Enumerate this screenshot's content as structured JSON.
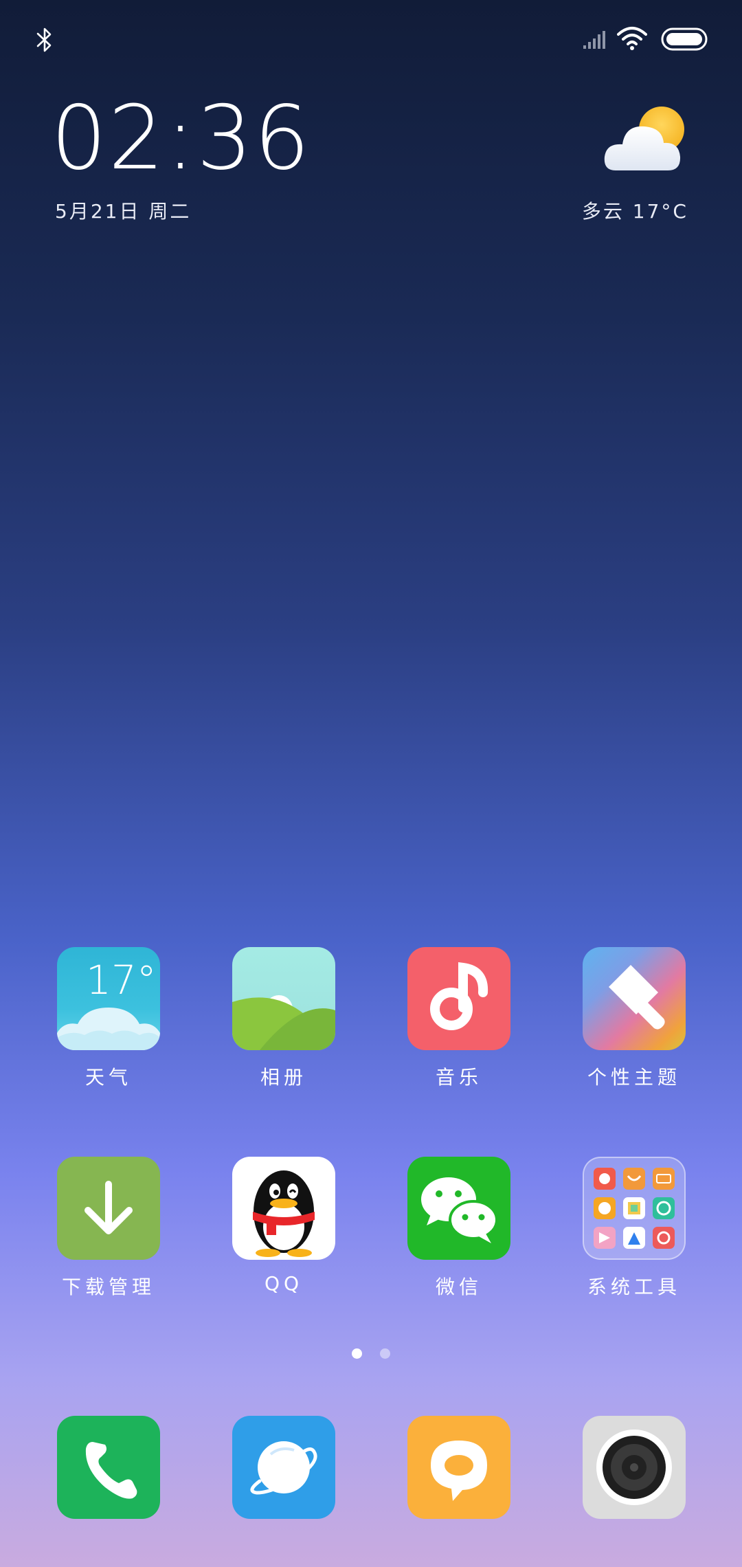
{
  "status_bar": {
    "bluetooth_icon": "bluetooth-icon",
    "signal_icon": "signal-icon",
    "wifi_icon": "wifi-icon",
    "battery_icon": "battery-icon"
  },
  "clock": {
    "time": "02:36",
    "date": "5月21日  周二"
  },
  "weather": {
    "icon": "partly-cloudy-icon",
    "text": "多云  17°C"
  },
  "apps": [
    {
      "label": "天气",
      "icon": "weather-app-icon",
      "badge_text": "17°"
    },
    {
      "label": "相册",
      "icon": "gallery-icon"
    },
    {
      "label": "音乐",
      "icon": "music-icon"
    },
    {
      "label": "个性主题",
      "icon": "themes-icon"
    },
    {
      "label": "下载管理",
      "icon": "downloads-icon"
    },
    {
      "label": "QQ",
      "icon": "qq-icon"
    },
    {
      "label": "微信",
      "icon": "wechat-icon"
    },
    {
      "label": "系统工具",
      "icon": "system-tools-folder-icon"
    }
  ],
  "dock": [
    {
      "icon": "phone-icon"
    },
    {
      "icon": "browser-icon"
    },
    {
      "icon": "messages-icon"
    },
    {
      "icon": "camera-icon"
    }
  ],
  "page_indicator": {
    "current_page": 1,
    "total_pages": 2
  },
  "colors": {
    "music": "#f4606a",
    "downloads": "#86b651",
    "wechat": "#21b829",
    "phone": "#1db35a",
    "browser": "#2f9ee8",
    "messages": "#fbb03b",
    "camera": "#dcdcdc"
  }
}
